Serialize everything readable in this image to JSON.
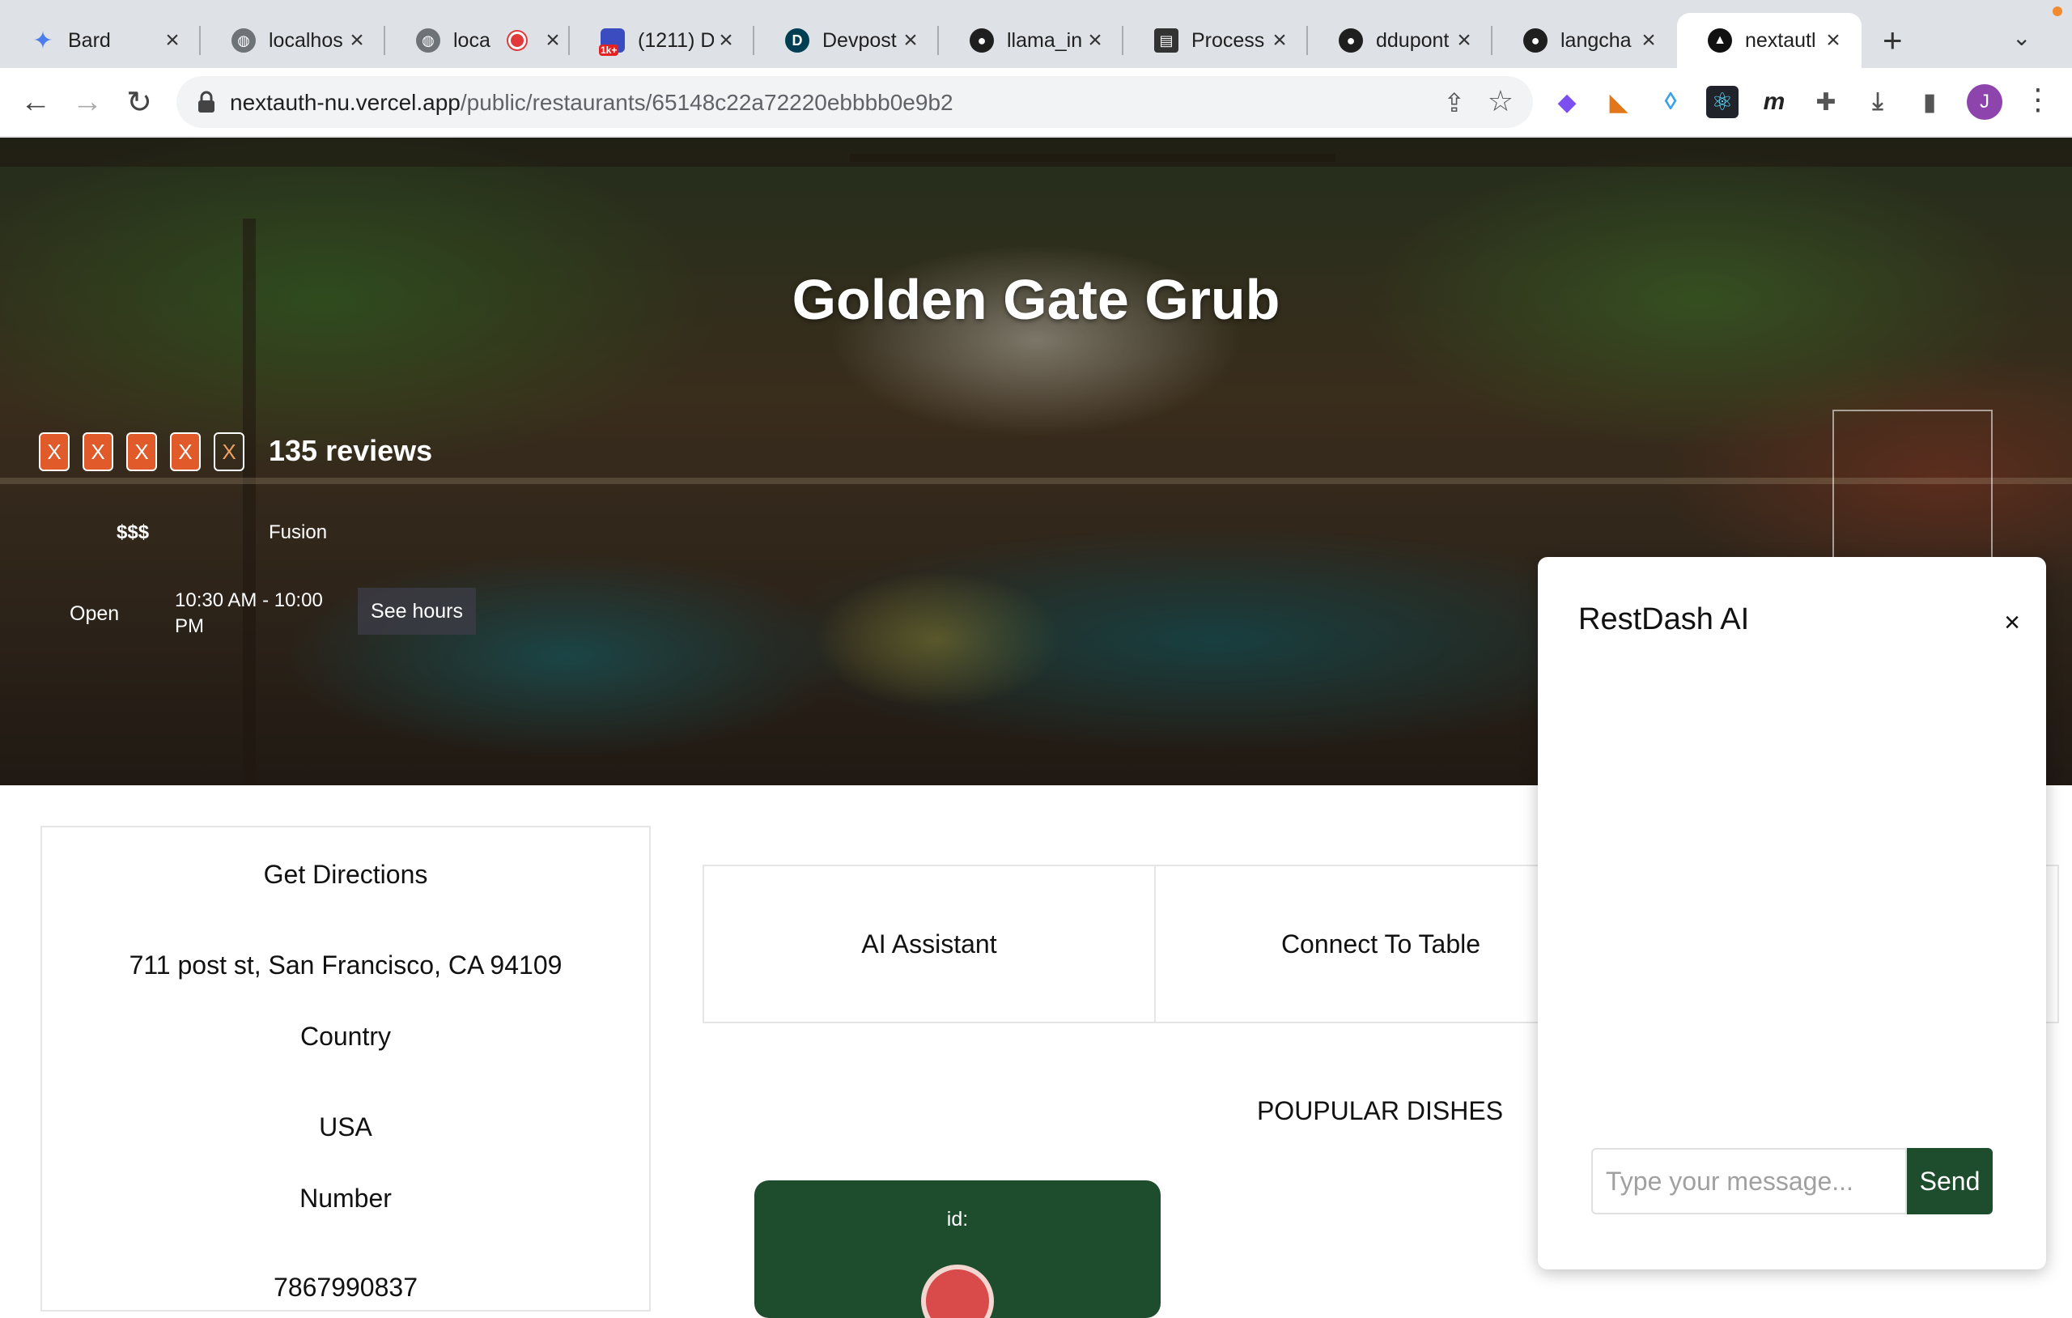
{
  "browser": {
    "tabs": [
      {
        "title": "Bard",
        "icon": "sparkle-icon"
      },
      {
        "title": "localhos",
        "icon": "globe-icon"
      },
      {
        "title": "loca",
        "icon": "globe-icon"
      },
      {
        "title": "(1211) D",
        "icon": "badge-icon",
        "badge": "1k+"
      },
      {
        "title": "Devpost",
        "icon": "devpost-icon",
        "glyph": "D"
      },
      {
        "title": "llama_in",
        "icon": "github-icon"
      },
      {
        "title": "Process",
        "icon": "notebook-icon"
      },
      {
        "title": "ddupont",
        "icon": "github-icon"
      },
      {
        "title": "langcha",
        "icon": "github-icon"
      },
      {
        "title": "nextautl",
        "icon": "vercel-icon"
      }
    ],
    "url_host": "nextauth-nu.vercel.app",
    "url_path": "/public/restaurants/65148c22a72220ebbbb0e9b2",
    "profile_initial": "J",
    "extension_glyph_m": "m"
  },
  "restaurant": {
    "name": "Golden Gate Grub",
    "rating_marks": [
      "X",
      "X",
      "X",
      "X",
      "X"
    ],
    "reviews": "135 reviews",
    "price": "$$$",
    "cuisine": "Fusion",
    "status": "Open",
    "hours": "10:30 AM - 10:00 PM",
    "see_hours": "See hours"
  },
  "info": {
    "directions": "Get Directions",
    "address": "711 post st, San Francisco, CA 94109",
    "country_label": "Country",
    "country_value": "USA",
    "number_label": "Number",
    "number_value": "7867990837"
  },
  "actions": {
    "ai_assistant": "AI Assistant",
    "connect_table": "Connect To Table"
  },
  "popular": {
    "heading": "POUPULAR DISHES",
    "dish_id_label": "id:"
  },
  "chat": {
    "title": "RestDash AI",
    "close": "×",
    "placeholder": "Type your message...",
    "send": "Send"
  },
  "colors": {
    "accent_green": "#1d4d2c",
    "star_orange": "#e05a2a"
  }
}
